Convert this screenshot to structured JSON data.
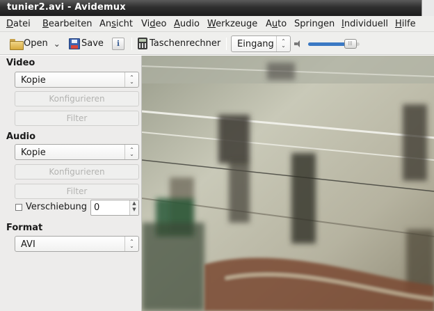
{
  "window": {
    "title": "tunier2.avi - Avidemux"
  },
  "menubar": {
    "items": [
      {
        "pre": "",
        "key": "D",
        "post": "atei"
      },
      {
        "pre": "",
        "key": "B",
        "post": "earbeiten"
      },
      {
        "pre": "An",
        "key": "s",
        "post": "icht"
      },
      {
        "pre": "Vi",
        "key": "d",
        "post": "eo"
      },
      {
        "pre": "",
        "key": "A",
        "post": "udio"
      },
      {
        "pre": "",
        "key": "W",
        "post": "erkzeuge"
      },
      {
        "pre": "A",
        "key": "u",
        "post": "to"
      },
      {
        "pre": "Sprin",
        "key": "g",
        "post": "en"
      },
      {
        "pre": "",
        "key": "I",
        "post": "ndividuell"
      },
      {
        "pre": "",
        "key": "H",
        "post": "ilfe"
      }
    ]
  },
  "toolbar": {
    "open_label": "Open",
    "save_label": "Save",
    "calc_label": "Taschenrechner",
    "source_select": {
      "value": "Eingang"
    },
    "volume": {
      "level": 0.82
    }
  },
  "sidebar": {
    "video": {
      "heading": "Video",
      "codec_value": "Kopie",
      "configure_label": "Konfigurieren",
      "filter_label": "Filter"
    },
    "audio": {
      "heading": "Audio",
      "codec_value": "Kopie",
      "configure_label": "Konfigurieren",
      "filter_label": "Filter",
      "shift_label": "Verschiebung",
      "shift_checked": false,
      "shift_value": "0"
    },
    "format": {
      "heading": "Format",
      "container_value": "AVI"
    }
  },
  "icons": {
    "open": "folder-icon",
    "save": "floppy-icon",
    "properties": "properties-icon",
    "calculator": "calculator-icon",
    "volume": "speaker-icon"
  },
  "colors": {
    "titlebar": "#2f2f2f",
    "accent": "#3b79c4",
    "panel": "#edeceb"
  }
}
